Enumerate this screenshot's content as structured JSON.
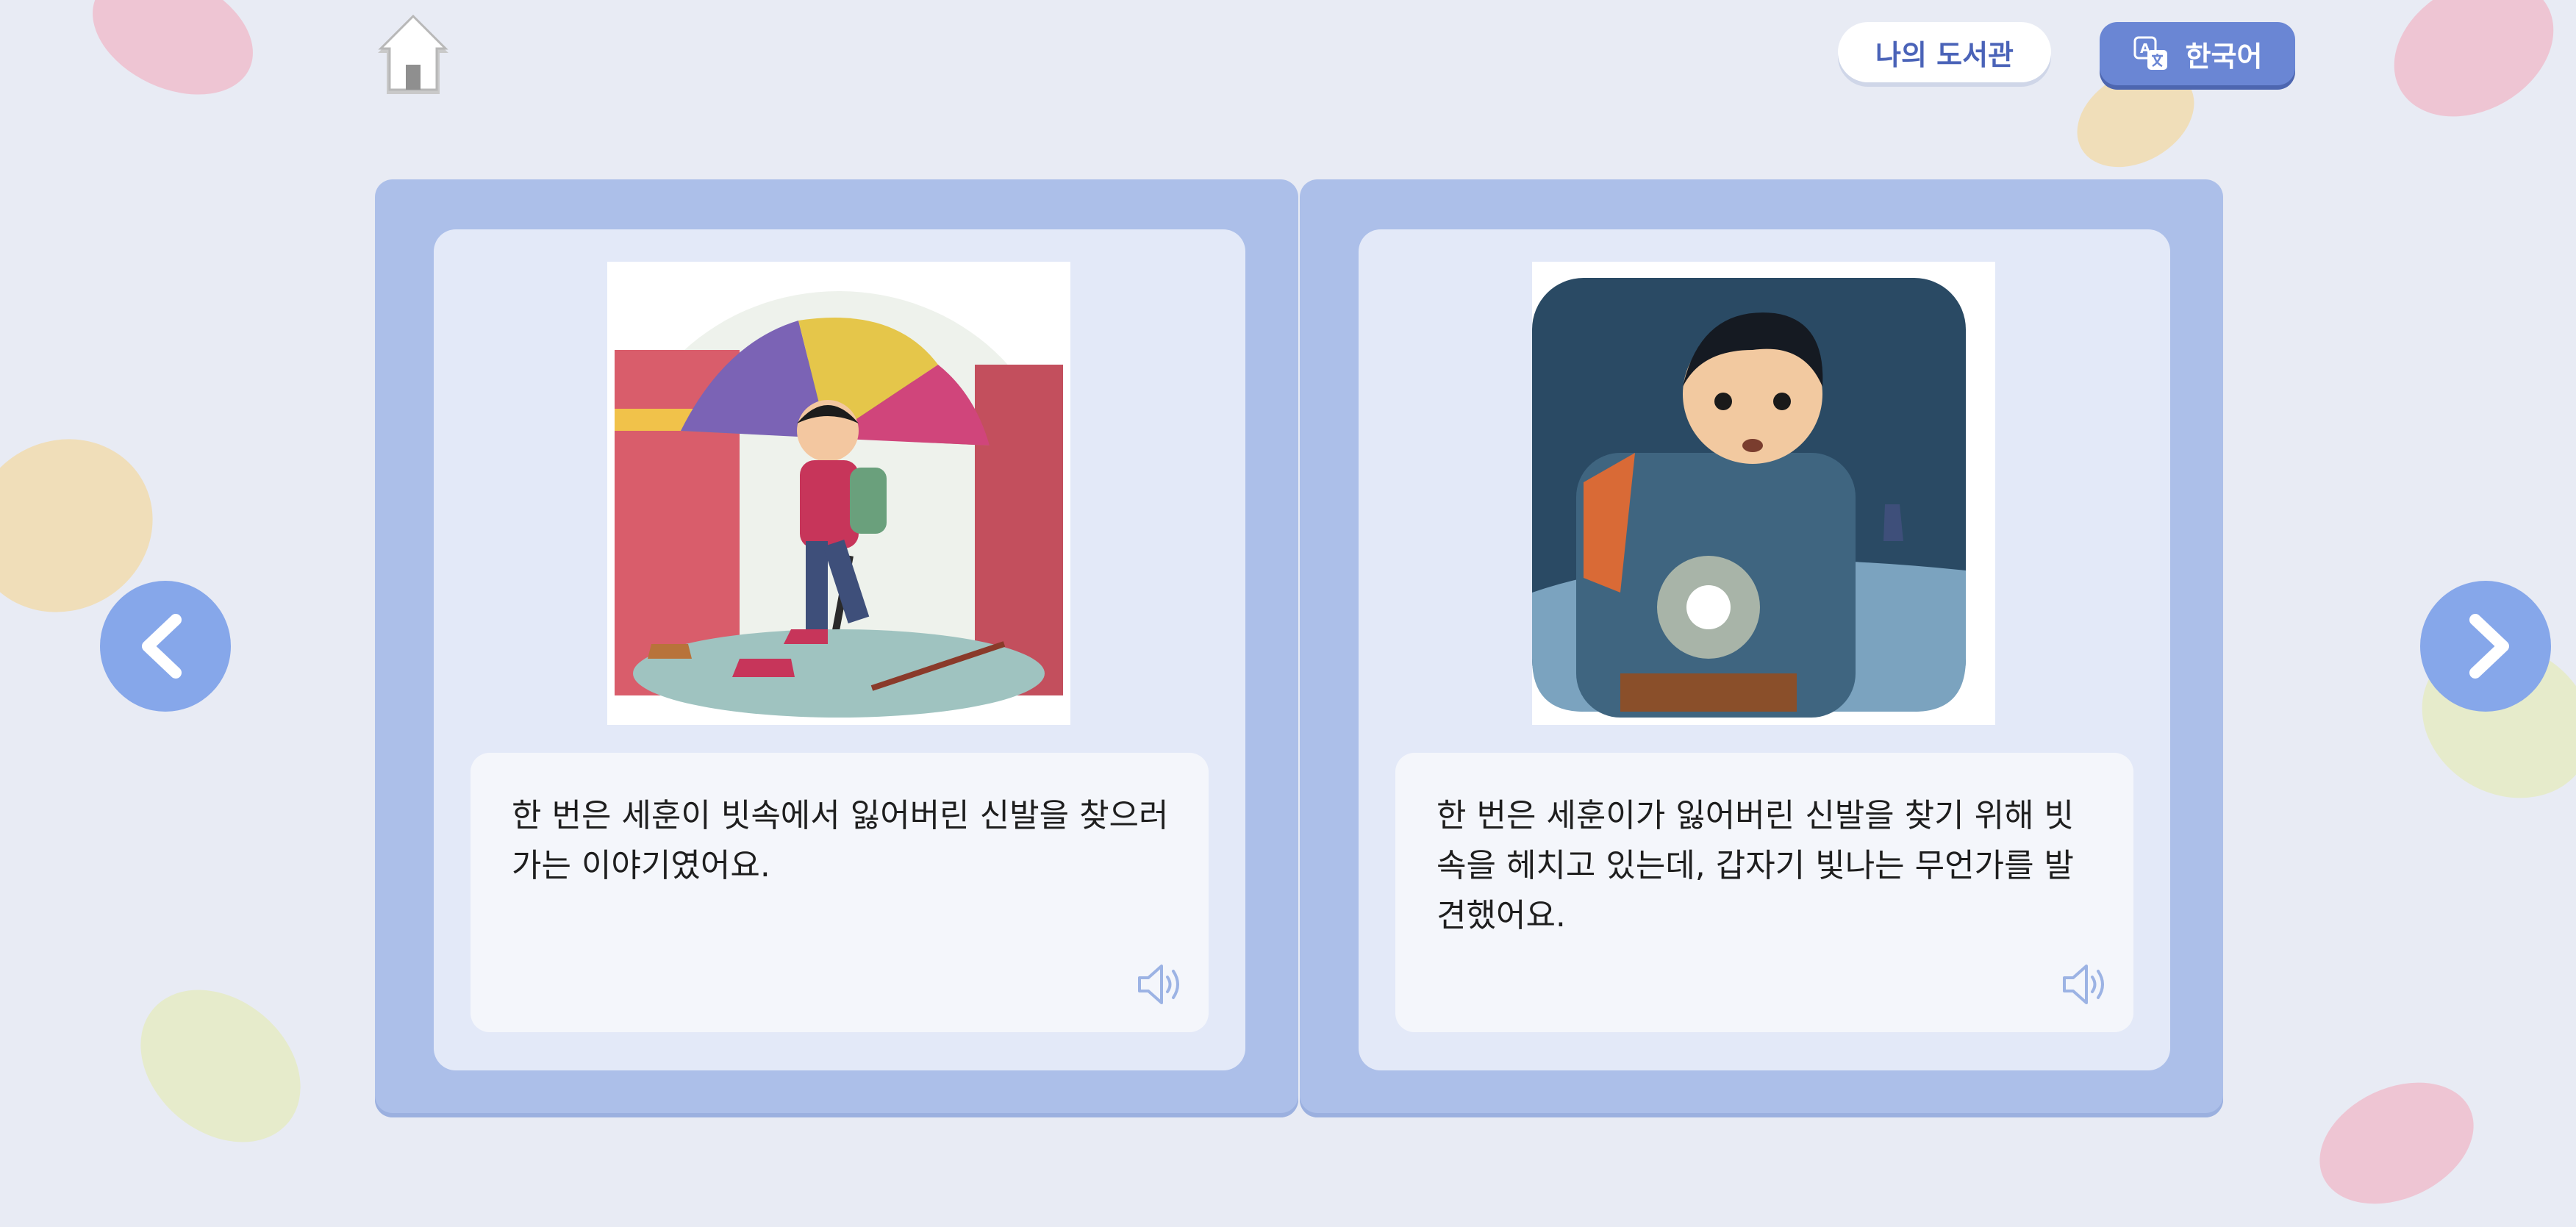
{
  "header": {
    "home_icon": "home-icon",
    "library_label": "나의 도서관",
    "language_label": "한국어",
    "language_icon": "translate-icon"
  },
  "pages": [
    {
      "text": "한 번은 세훈이 빗속에서 잃어버린 신발을 찾으러 가는 이야기였어요.",
      "illustration": "boy-with-umbrella-in-rain",
      "speaker_icon": "speaker-icon"
    },
    {
      "text": "한 번은 세훈이가 잃어버린 신발을 찾기 위해 빗속을 헤치고 있는데, 갑자기 빛나는 무언가를 발견했어요.",
      "illustration": "boy-with-glowing-object-in-storm",
      "speaker_icon": "speaker-icon"
    }
  ],
  "navigation": {
    "prev_icon": "chevron-left-icon",
    "next_icon": "chevron-right-icon"
  },
  "colors": {
    "background": "#e8ebf4",
    "book": "#acbfe9",
    "accent": "#6a86d4",
    "nav": "#86a7ea"
  }
}
